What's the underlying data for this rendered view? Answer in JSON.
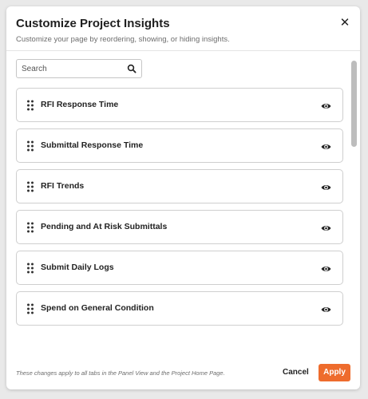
{
  "modal": {
    "title": "Customize Project Insights",
    "subtitle": "Customize your page by reordering, showing, or hiding insights.",
    "close_icon": "close-icon",
    "close_glyph": "✕"
  },
  "search": {
    "placeholder": "Search",
    "value": "",
    "icon": "search-icon"
  },
  "insights": [
    {
      "label": "RFI Response Time",
      "visible": true
    },
    {
      "label": "Submittal Response Time",
      "visible": true
    },
    {
      "label": "RFI Trends",
      "visible": true
    },
    {
      "label": "Pending and At Risk Submittals",
      "visible": true
    },
    {
      "label": "Submit Daily Logs",
      "visible": true
    },
    {
      "label": "Spend on General Condition",
      "visible": true
    }
  ],
  "icons": {
    "drag": "drag-handle-icon",
    "visibility": "eye-icon"
  },
  "footer": {
    "note": "These changes apply to all tabs in the Panel View and the Project Home Page.",
    "cancel_label": "Cancel",
    "apply_label": "Apply"
  },
  "colors": {
    "accent": "#ee6c2d",
    "text": "#222222",
    "border": "#cfcfcf"
  }
}
